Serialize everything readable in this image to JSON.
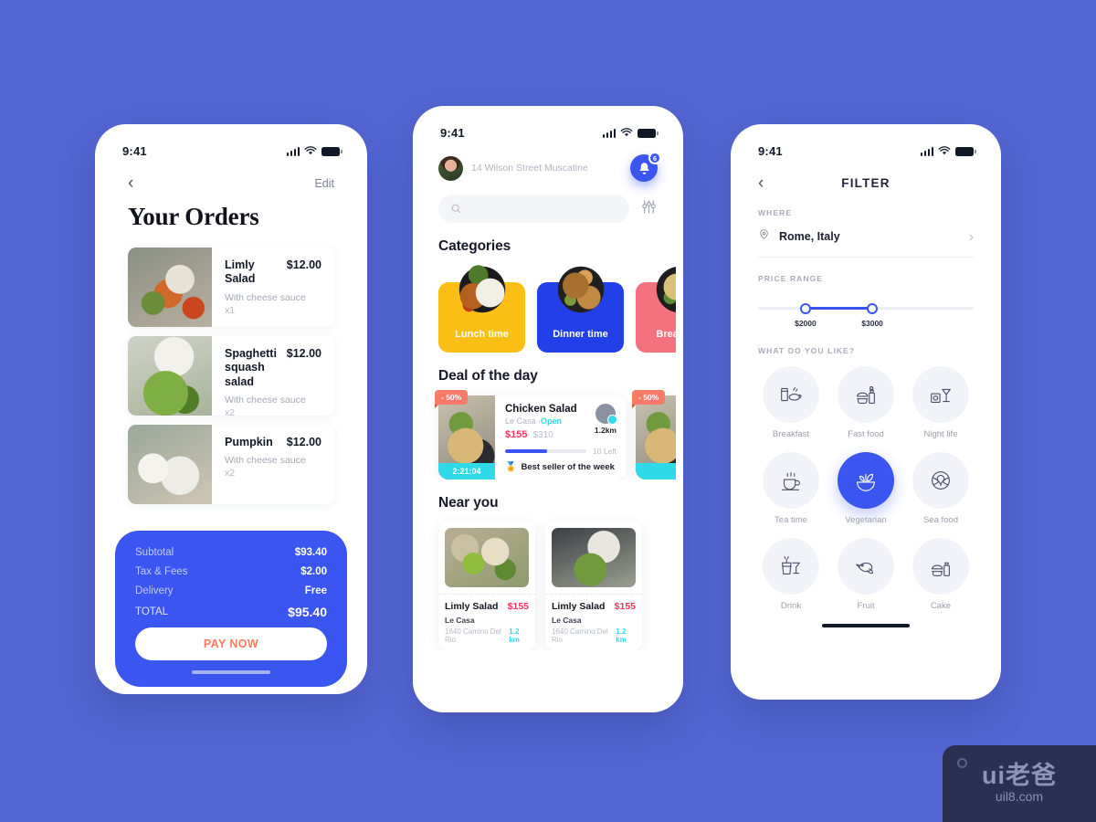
{
  "theme": {
    "background": "#5366d2",
    "accent_blue": "#3b55f0",
    "accent_pink": "#f5365c",
    "accent_cyan": "#2fd9e8",
    "accent_coral": "#fa7a68",
    "yellow": "#fbbf16"
  },
  "status_bar": {
    "time": "9:41"
  },
  "phone1": {
    "nav": {
      "back_icon": "chevron-left-icon",
      "edit_label": "Edit"
    },
    "title": "Your Orders",
    "orders": [
      {
        "name": "Limly Salad",
        "price": "$12.00",
        "desc": "With cheese sauce",
        "qty": "x1"
      },
      {
        "name": "Spaghetti squash salad",
        "price": "$12.00",
        "desc": "With cheese sauce",
        "qty": "x2"
      },
      {
        "name": "Pumpkin",
        "price": "$12.00",
        "desc": "With cheese sauce",
        "qty": "x2"
      }
    ],
    "summary": {
      "rows": [
        {
          "label": "Subtotal",
          "value": "$93.40"
        },
        {
          "label": "Tax & Fees",
          "value": "$2.00"
        },
        {
          "label": "Delivery",
          "value": "Free"
        }
      ],
      "total_label": "TOTAL",
      "total_value": "$95.40",
      "pay_label": "PAY NOW"
    }
  },
  "phone2": {
    "address": "14 Wilson Street Muscatine",
    "notification_count": "6",
    "search_placeholder": "",
    "categories_title": "Categories",
    "categories": [
      {
        "label": "Lunch time",
        "color": "#fbbf16"
      },
      {
        "label": "Dinner time",
        "color": "#2340e8"
      },
      {
        "label": "Breakfast",
        "color": "#f4717e"
      }
    ],
    "deal_title": "Deal of the day",
    "deals": [
      {
        "discount": "- 50%",
        "timer": "2:21:04",
        "name": "Chicken Salad",
        "restaurant": "Le Casa ·",
        "status": "Open",
        "price_now": "$155",
        "price_old": "$310",
        "distance": "1.2km",
        "left": "10 Left",
        "progress": 52,
        "seller_badge": "Best seller of the week"
      },
      {
        "discount": "- 50%",
        "timer": ""
      }
    ],
    "near_title": "Near you",
    "near": [
      {
        "name": "Limly Salad",
        "price": "$155",
        "restaurant": "Le Casa",
        "address": "1640 Camino Del Rio",
        "distance": "1.2 km"
      },
      {
        "name": "Limly Salad",
        "price": "$155",
        "restaurant": "Le Casa",
        "address": "1640 Camino Del Rio",
        "distance": "1.2 km"
      }
    ]
  },
  "phone3": {
    "title": "FILTER",
    "where_label": "WHERE",
    "where_value": "Rome, Italy",
    "price_label": "PRICE RANGE",
    "price_min": "$2000",
    "price_max": "$3000",
    "likes_label": "WHAT DO YOU LIKE?",
    "likes": [
      {
        "label": "Breakfast",
        "icon": "breakfast-icon",
        "selected": false
      },
      {
        "label": "Fast food",
        "icon": "fastfood-icon",
        "selected": false
      },
      {
        "label": "Night life",
        "icon": "nightlife-icon",
        "selected": false
      },
      {
        "label": "Tea time",
        "icon": "teatime-icon",
        "selected": false
      },
      {
        "label": "Vegetarian",
        "icon": "vegetarian-icon",
        "selected": true
      },
      {
        "label": "Sea food",
        "icon": "seafood-icon",
        "selected": false
      },
      {
        "label": "Drink",
        "icon": "drink-icon",
        "selected": false
      },
      {
        "label": "Fruit",
        "icon": "fruit-icon",
        "selected": false
      },
      {
        "label": "Cake",
        "icon": "cake-icon",
        "selected": false
      }
    ]
  },
  "watermark": {
    "logo": "ui老爸",
    "url": "uil8.com"
  }
}
